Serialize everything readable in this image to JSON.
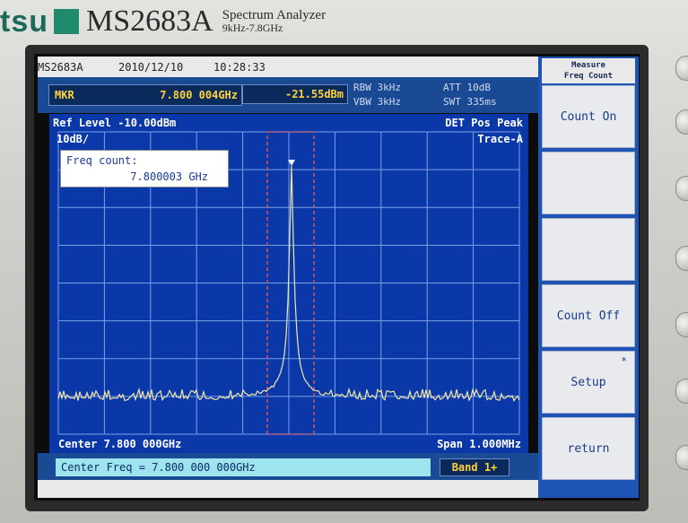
{
  "brand": {
    "logo_text": "tsu",
    "model": "MS2683A",
    "description_line1": "Spectrum Analyzer",
    "description_line2": "9kHz-7.8GHz"
  },
  "status_bar": {
    "model": "MS2683A",
    "date": "2010/12/10",
    "time": "10:28:33"
  },
  "marker": {
    "label": "MKR",
    "frequency": "7.800 004GHz",
    "level": "-21.55dBm"
  },
  "settings": {
    "rbw": "RBW 3kHz",
    "vbw": "VBW 3kHz",
    "att": "ATT 10dB",
    "swt": "SWT 335ms"
  },
  "graph": {
    "ref_level": "Ref Level -10.00dBm",
    "scale": "10dB/",
    "detector": "DET  Pos Peak",
    "trace": "Trace-A",
    "center": "Center 7.800 000GHz",
    "span": "Span 1.000MHz",
    "colors": {
      "background": "#0b38a8",
      "grid": "#7aa0e8",
      "trace": "#f2e6a8",
      "gate": "#e05050"
    }
  },
  "freq_count_box": {
    "title": "Freq count:",
    "value": "7.800003 GHz"
  },
  "input_bar": {
    "entry": "Center Freq = 7.800 000 000GHz",
    "band": "Band 1+"
  },
  "softkeys": {
    "title_line1": "Measure",
    "title_line2": "Freq Count",
    "keys": [
      {
        "label": "Count On",
        "star": ""
      },
      {
        "label": "",
        "star": ""
      },
      {
        "label": "",
        "star": ""
      },
      {
        "label": "Count Off",
        "star": ""
      },
      {
        "label": "Setup",
        "star": "*"
      },
      {
        "label": "return",
        "star": ""
      }
    ]
  }
}
